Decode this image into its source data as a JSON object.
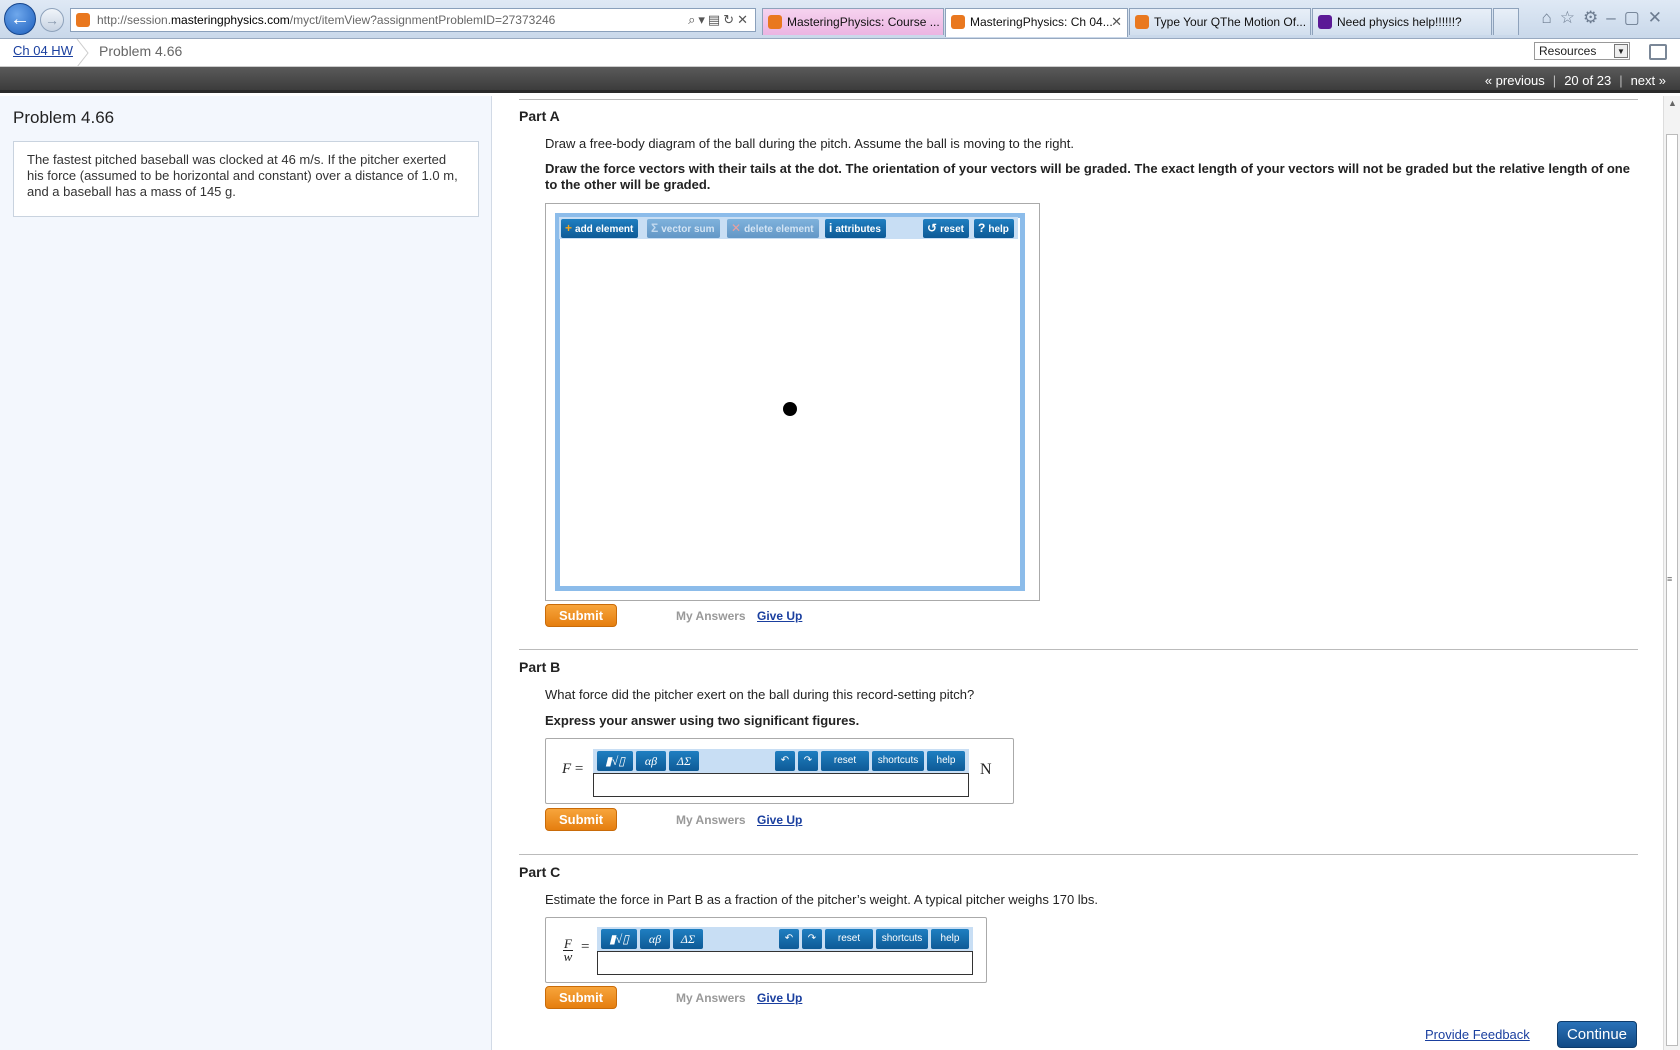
{
  "browser": {
    "url_prefix": "http://session.",
    "url_domain": "masteringphysics.com",
    "url_path": "/myct/itemView?assignmentProblemID=27373246",
    "tabs": [
      {
        "label": "MasteringPhysics: Course ...",
        "icon": "mastering-icon",
        "color": "#e9781f"
      },
      {
        "label": "MasteringPhysics: Ch 04...",
        "icon": "mastering-icon",
        "color": "#e9781f"
      },
      {
        "label": "Type Your QThe Motion Of...",
        "icon": "chegg-icon",
        "color": "#e9781f"
      },
      {
        "label": "Need physics help!!!!!!?",
        "icon": "yahoo-icon",
        "color": "#5b1a96"
      }
    ]
  },
  "header": {
    "breadcrumb_link": "Ch 04 HW",
    "breadcrumb_current": "Problem 4.66",
    "resources_select": "Resources"
  },
  "pager": {
    "previous": "« previous",
    "position": "20 of 23",
    "next": "next »"
  },
  "problem": {
    "title": "Problem 4.66",
    "text": "The fastest pitched baseball was clocked at 46 m/s. If the pitcher exerted his force (assumed to be horizontal and constant) over a distance of 1.0 m, and a baseball has a mass of 145 g."
  },
  "partA": {
    "title": "Part A",
    "prompt": "Draw a free-body diagram of the ball during the pitch. Assume the ball is moving to the right.",
    "instruction": "Draw the force vectors with their tails at the dot. The orientation of your vectors will be graded. The exact length of your vectors will not be graded but the relative length of one to the other will be graded.",
    "toolbar": {
      "add_element": "add element",
      "vector_sum": "vector sum",
      "delete_element": "delete element",
      "attributes": "attributes",
      "reset": "reset",
      "help": "help"
    }
  },
  "partB": {
    "title": "Part B",
    "prompt": "What force did the pitcher exert on the ball during this record-setting pitch?",
    "instruction": "Express your answer using two significant figures.",
    "label_var": "F",
    "label_eq": " =",
    "unit": "N",
    "input_value": ""
  },
  "partC": {
    "title": "Part C",
    "prompt": "Estimate the force in Part B as a fraction of the pitcher’s weight. A typical pitcher weighs 170 lbs.",
    "frac_num": "F",
    "frac_den": "w",
    "label_eq": "=",
    "input_value": ""
  },
  "eq_toolbar": {
    "templates": "▮√▯",
    "greek": "αβ",
    "symbols": "ΔΣ",
    "undo": "↶",
    "redo": "↷",
    "reset": "reset",
    "shortcuts": "shortcuts",
    "help": "help"
  },
  "actions": {
    "submit": "Submit",
    "my_answers": "My Answers",
    "give_up": "Give Up",
    "feedback": "Provide Feedback",
    "continue": "Continue"
  },
  "colors": {
    "accent_orange": "#e57e0f",
    "link_blue": "#1a3f9f",
    "tool_blue": "#0e5a96",
    "panel_bg": "#f3f7fd"
  }
}
